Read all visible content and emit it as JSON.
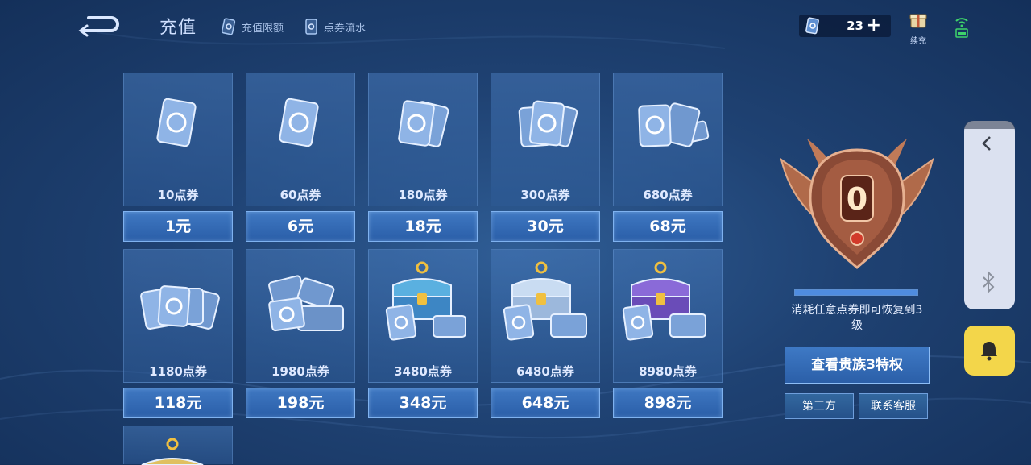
{
  "header": {
    "title": "充值",
    "links": [
      {
        "label": "充值限额",
        "icon": "coupon-card-icon"
      },
      {
        "label": "点券流水",
        "icon": "coupon-record-icon"
      }
    ],
    "coupon_balance": "23",
    "plus_label": "+",
    "renew_label": "续充"
  },
  "products": [
    {
      "amount": "10点券",
      "price": "1元",
      "art": "single-coupon"
    },
    {
      "amount": "60点券",
      "price": "6元",
      "art": "single-coupon"
    },
    {
      "amount": "180点券",
      "price": "18元",
      "art": "two-coupons"
    },
    {
      "amount": "300点券",
      "price": "30元",
      "art": "three-coupons"
    },
    {
      "amount": "680点券",
      "price": "68元",
      "art": "three-coupons-extra"
    },
    {
      "amount": "1180点券",
      "price": "118元",
      "art": "coupon-fan"
    },
    {
      "amount": "1980点券",
      "price": "198元",
      "art": "coupon-stack"
    },
    {
      "amount": "3480点券",
      "price": "348元",
      "art": "chest-blue"
    },
    {
      "amount": "6480点券",
      "price": "648元",
      "art": "chest-silver"
    },
    {
      "amount": "8980点券",
      "price": "898元",
      "art": "chest-purple"
    }
  ],
  "noble": {
    "level": "0",
    "progress": 1.0,
    "restore_text": "消耗任意点券即可恢复到3级",
    "privilege_button": "查看贵族3特权",
    "third_party_button": "第三方",
    "support_button": "联系客服"
  },
  "colors": {
    "background": "#1f4273",
    "tile": "#3d6fae",
    "price_button": "#3f78c2",
    "bell_button": "#f3d64a"
  }
}
